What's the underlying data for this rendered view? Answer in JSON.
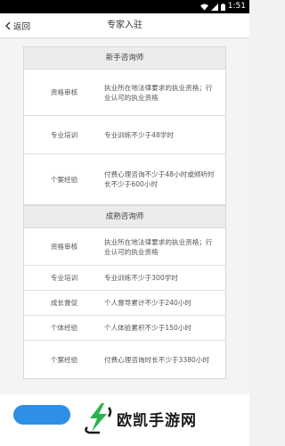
{
  "status_bar": {
    "time": "1:51"
  },
  "nav": {
    "back_label": "返回",
    "title": "专家入驻"
  },
  "cards": [
    {
      "title": "新手咨询师",
      "rows": [
        {
          "label": "资格审核",
          "value": "执业所在地法律要求的执业资格；行业认可的执业资格"
        },
        {
          "label": "专业培训",
          "value": "专业训练不少于48学时"
        },
        {
          "label": "个案经验",
          "value": "付费心理咨询不少于48小时或倾听时长不少于600小时"
        }
      ]
    },
    {
      "title": "成熟咨询师",
      "rows": [
        {
          "label": "资格审核",
          "value": "执业所在地法律要求的执业资格；行业认可的执业资格"
        },
        {
          "label": "专业培训",
          "value": "专业训练不少于300学时"
        },
        {
          "label": "成长督促",
          "value": "个人督导累计不少于240小时"
        },
        {
          "label": "个体经验",
          "value": "个人体验累积不少于150小时"
        },
        {
          "label": "个案经验",
          "value": "付费心理咨询时长不少于3380小时"
        }
      ]
    }
  ],
  "banner": {
    "text": "欧凯手游网"
  },
  "colors": {
    "accent": "#2e8fe6",
    "logo_green": "#2bb24c"
  }
}
